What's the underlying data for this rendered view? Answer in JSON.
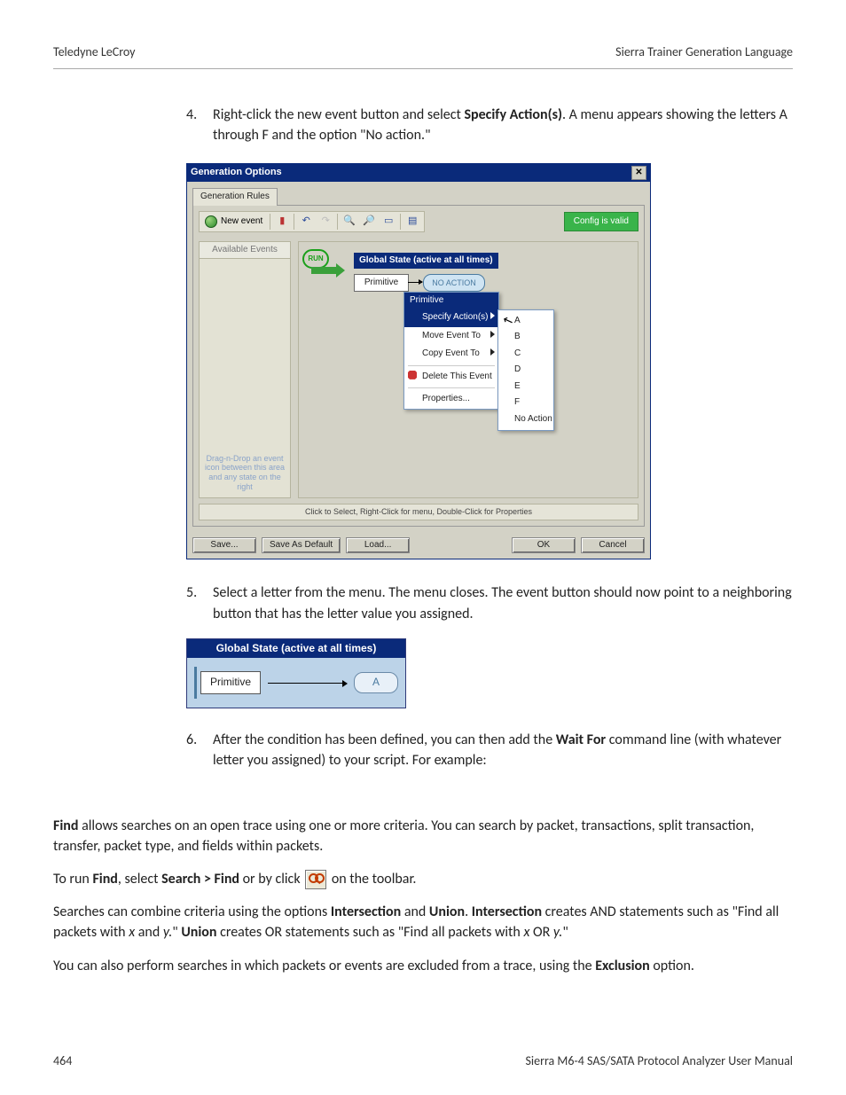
{
  "header": {
    "left": "Teledyne LeCroy",
    "right": "Sierra Trainer Generation Language"
  },
  "steps": {
    "s4": {
      "num": "4.",
      "pre": "Right-click the new event button and select ",
      "bold": "Specify Action(s)",
      "post": ". A menu appears showing the letters A through F and the option \"No action.\""
    },
    "s5": {
      "num": "5.",
      "text": "Select a letter from the menu. The menu closes. The event button should now point to a neighboring button that has the letter value you assigned."
    },
    "s6": {
      "num": "6.",
      "pre": "After the condition has been defined, you can then add the ",
      "bold": "Wait For",
      "post": " command line (with whatever letter you assigned) to your script. For example:"
    }
  },
  "dialog": {
    "title": "Generation Options",
    "tab": "Generation Rules",
    "newEvent": "New event",
    "configValid": "Config is valid",
    "availableHead": "Available Events",
    "dragHint": "Drag-n-Drop an event icon between this area and any state on the right",
    "stateHeader": "Global State (active at all times)",
    "primitive": "Primitive",
    "noAction": "NO ACTION",
    "run": "RUN",
    "ctx": {
      "title": "Primitive",
      "specify": "Specify Action(s)",
      "move": "Move Event To",
      "copy": "Copy Event To",
      "del": "Delete This Event",
      "prop": "Properties..."
    },
    "sub": {
      "A": "A",
      "B": "B",
      "C": "C",
      "D": "D",
      "E": "E",
      "F": "F",
      "no": "No Action"
    },
    "status": "Click to Select, Right-Click for menu, Double-Click for Properties",
    "buttons": {
      "save": "Save...",
      "saveDefault": "Save As Default",
      "load": "Load...",
      "ok": "OK",
      "cancel": "Cancel"
    }
  },
  "gsfig": {
    "title": "Global State (active at all times)",
    "primitive": "Primitive",
    "letter": "A"
  },
  "find": {
    "p1a": "Find",
    "p1b": " allows searches on an open trace using one or more criteria. You can search by packet, transactions, split transaction, transfer, packet type, and fields within packets.",
    "p2a": "To run ",
    "p2b": "Find",
    "p2c": ", select ",
    "p2d": "Search > Find",
    "p2e": " or by click ",
    "p2f": " on the toolbar.",
    "p3a": "Searches can combine criteria using the options ",
    "p3b": "Intersection",
    "p3c": " and ",
    "p3d": "Union",
    "p3e": ". ",
    "p3f": "Intersection",
    "p3g": " creates AND statements such as \"Find all packets with ",
    "p3h": "x",
    "p3i": " and ",
    "p3j": "y.",
    "p3k": "\" ",
    "p3l": "Union",
    "p3m": " creates OR statements such as \"Find all packets with ",
    "p3n": "x",
    "p3o": " OR ",
    "p3p": "y.",
    "p3q": "\"",
    "p4a": "You can also perform searches in which packets or events are excluded from a trace, using the ",
    "p4b": "Exclusion",
    "p4c": " option."
  },
  "footer": {
    "page": "464",
    "manual": "Sierra M6-4 SAS/SATA Protocol Analyzer User Manual"
  }
}
